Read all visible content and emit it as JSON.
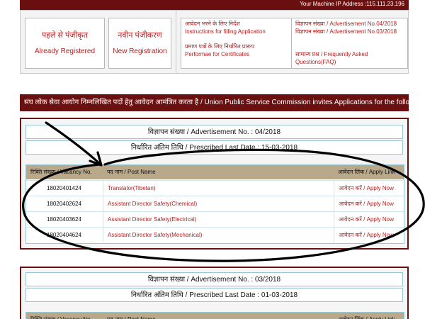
{
  "header": {
    "ip_text": "Your Machine IP Address :115.111.23.196"
  },
  "registration": {
    "already": {
      "hi": "पहले से पंजीकृत",
      "en": "Already Registered"
    },
    "new": {
      "hi": "नवीन पंजीकरण",
      "en": "New Registration"
    }
  },
  "links": {
    "instructions_hi": "आवेदन भरने के लिए निर्देश",
    "instructions_en": "Instructions for filling Application",
    "performae_hi": "प्रमाण पत्रों के लिए निर्धारित प्रारूप",
    "performae_en": "Performae for Certificates",
    "advt_04": "विज्ञापन संख्या / Advertisement No.04/2018",
    "advt_03": "विज्ञापन संख्या / Advertisement No.03/2018",
    "faq_line1": "सामान्य प्रश्न / Frequently Asked",
    "faq_line2": "Questions(FAQ)"
  },
  "notice": "संघ लोक सेवा आयोग निम्नलिखित पदों हेतु आवेदन आमंत्रित करता है / Union Public Service Commission invites Applications for the following Posts",
  "advertisements": [
    {
      "title": "विज्ञापन संख्या / Advertisement No. : 04/2018",
      "last_date": "निर्धारित अंतिम तिथि / Prescribed Last Date : 15-03-2018",
      "columns": [
        "रिक्ति संख्या / Vacancy No.",
        "पद नाम / Post Name",
        "आवेदन लिंक / Apply Link"
      ],
      "rows": [
        {
          "vacancy": "18020401424",
          "post": "Translator(Tibetan)",
          "apply": "आवेदन करें / Apply Now"
        },
        {
          "vacancy": "18020402624",
          "post": "Assistant Director Safety(Chemical)",
          "apply": "आवेदन करें / Apply Now"
        },
        {
          "vacancy": "18020403624",
          "post": "Assistant Director Safety(Electrical)",
          "apply": "आवेदन करें / Apply Now"
        },
        {
          "vacancy": "18020404624",
          "post": "Assistant Director Safety(Mechanical)",
          "apply": "आवेदन करें / Apply Now"
        }
      ]
    },
    {
      "title": "विज्ञापन संख्या / Advertisement No. : 03/2018",
      "last_date": "निर्धारित अंतिम तिथि / Prescribed Last Date : 01-03-2018",
      "columns": [
        "रिक्ति संख्या / Vacancy No.",
        "पद नाम / Post Name",
        "आवेदन लिंक / Apply Link"
      ]
    }
  ],
  "colors": {
    "maroon": "#6b1010",
    "link_red": "#b32020",
    "table_header": "#b9a889",
    "table_border": "#9ac7d6",
    "annotation": "#000000"
  },
  "annotation": {
    "shape": "hand-drawn ellipse with arrow pointing at the vacancy table"
  }
}
